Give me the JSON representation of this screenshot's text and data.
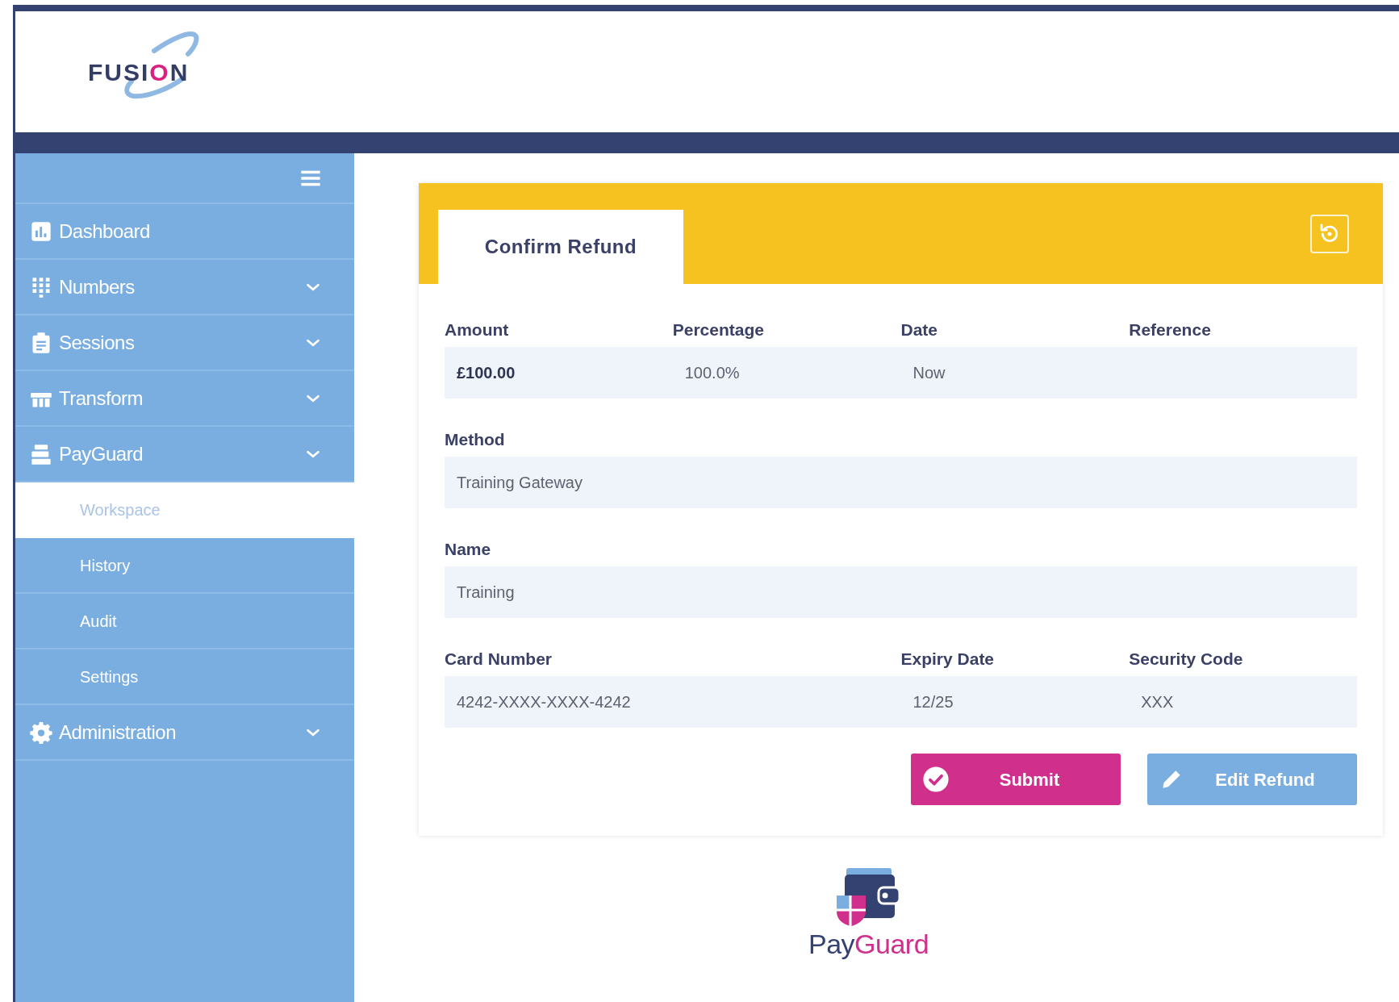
{
  "header": {
    "logo": "FUSION"
  },
  "sidebar": {
    "items": [
      {
        "label": "Dashboard",
        "kind": "link"
      },
      {
        "label": "Numbers",
        "kind": "group"
      },
      {
        "label": "Sessions",
        "kind": "group"
      },
      {
        "label": "Transform",
        "kind": "group"
      },
      {
        "label": "PayGuard",
        "kind": "group",
        "children": [
          {
            "label": "Workspace",
            "selected": true
          },
          {
            "label": "History",
            "selected": false
          },
          {
            "label": "Audit",
            "selected": false
          },
          {
            "label": "Settings",
            "selected": false
          }
        ]
      },
      {
        "label": "Administration",
        "kind": "group"
      }
    ]
  },
  "card": {
    "tab": "Confirm Refund",
    "rows": [
      {
        "fields": [
          {
            "label": "Amount",
            "value": "£100.00",
            "emphasis": true
          },
          {
            "label": "Percentage",
            "value": "100.0%",
            "emphasis": false
          },
          {
            "label": "Date",
            "value": "Now",
            "emphasis": false
          },
          {
            "label": "Reference"
          }
        ]
      },
      {
        "fields": [
          {
            "label": "Method",
            "value": "Training Gateway",
            "emphasis": false
          }
        ]
      },
      {
        "fields": [
          {
            "label": "Name",
            "value": "Training",
            "emphasis": false
          }
        ]
      },
      {
        "fields": [
          {
            "label": "Card Number",
            "value": "4242-XXXX-XXXX-4242",
            "emphasis": false
          },
          {
            "label": "Expiry Date",
            "value": "12/25",
            "emphasis": false
          },
          {
            "label": "Security Code",
            "value": "XXX",
            "emphasis": false
          }
        ]
      }
    ],
    "buttons": [
      {
        "label": "Submit",
        "kind": "primary"
      },
      {
        "label": "Edit Refund",
        "kind": "secondary"
      }
    ]
  },
  "footer_logo": {
    "text_start": "Pay",
    "text_end": "Guard"
  }
}
